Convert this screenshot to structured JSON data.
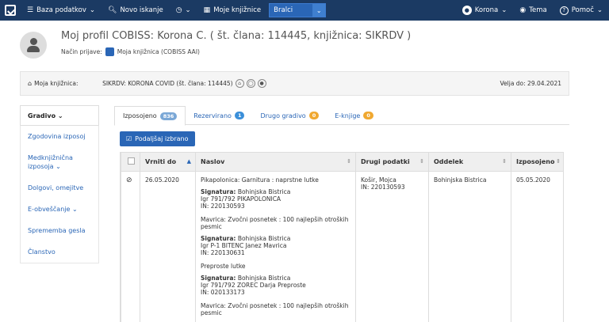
{
  "nav": {
    "db": "Baza podatkov",
    "search": "Novo iskanje",
    "my_libraries": "Moje knjižnice",
    "library_select": "Bralci",
    "user": "Korona",
    "theme": "Tema",
    "help": "Pomoč",
    "icons": [
      "cobiss-logo-icon",
      "database-icon",
      "search-icon",
      "history-icon",
      "library-icon",
      "user-icon",
      "eye-icon",
      "help-icon"
    ]
  },
  "profile": {
    "title": "Moj profil COBISS: Korona C. ( št. člana: 114445, knjižnica: SIKRDV )",
    "login_label": "Način prijave:",
    "login_value": "Moja knjižnica (COBISS AAI)"
  },
  "library_bar": {
    "label": "Moja knjižnica:",
    "value": "SIKRDV: KORONA COVID (št. člana: 114445)",
    "valid": "Velja do: 29.04.2021"
  },
  "sidebar": {
    "header": "Gradivo",
    "items": [
      {
        "label": "Zgodovina izposoj"
      },
      {
        "label": "Medknjižnična izposoja"
      },
      {
        "label": "Dolgovi, omejitve"
      },
      {
        "label": "E-obveščanje"
      },
      {
        "label": "Sprememba gesla"
      },
      {
        "label": "Članstvo"
      }
    ]
  },
  "tabs": [
    {
      "label": "Izposojeno",
      "badge": "836"
    },
    {
      "label": "Rezervirano",
      "badge": "1"
    },
    {
      "label": "Drugo gradivo",
      "badge": "0"
    },
    {
      "label": "E-knjige",
      "badge": "0"
    }
  ],
  "extend_button": "Podaljšaj izbrano",
  "table": {
    "headers": [
      "Vrniti do",
      "Naslov",
      "Drugi podatki",
      "Oddelek",
      "Izposojeno"
    ],
    "row": {
      "return_date": "26.05.2020",
      "other": [
        "Košir, Mojca",
        "IN: 220130593"
      ],
      "department": "Bohinjska Bistrica",
      "borrowed": "05.05.2020",
      "items": [
        {
          "title": "Pikapolonica: Garnitura : naprstne lutke",
          "sig_label": "Signatura:",
          "sig": "Bohinjska Bistrica",
          "call": "Igr 791/792 PIKAPOLONICA",
          "in": "IN: 220130593"
        },
        {
          "title": "Mavrica: Zvočni posnetek : 100 najlepših otroških pesmic",
          "sig_label": "Signatura:",
          "sig": "Bohinjska Bistrica",
          "call": "Igr P-1 BITENC Janez Mavrica",
          "in": "IN: 220130631"
        },
        {
          "title": "Preproste lutke",
          "sig_label": "Signatura:",
          "sig": "Bohinjska Bistrica",
          "call": "Igr 791/792 ZOREC Darja Preproste",
          "in": "IN: 020133173"
        },
        {
          "title": "Mavrica: Zvočni posnetek : 100 najlepših otroških pesmic"
        }
      ]
    }
  }
}
